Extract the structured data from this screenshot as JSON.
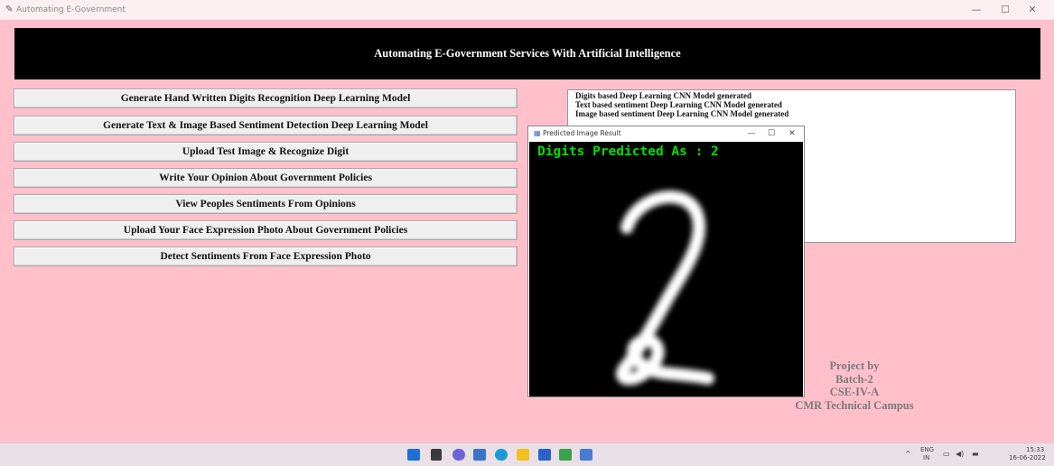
{
  "window": {
    "title": "Automating E-Government",
    "min_glyph": "—",
    "max_glyph": "☐",
    "close_glyph": "✕"
  },
  "header": {
    "title": "Automating E-Government Services With Artificial Intelligence"
  },
  "buttons": [
    "Generate Hand Written Digits Recognition Deep Learning Model",
    "Generate Text & Image Based Sentiment Detection Deep Learning Model",
    "Upload Test Image & Recognize Digit",
    "Write Your Opinion About Government Policies",
    "View Peoples Sentiments From Opinions",
    "Upload Your Face Expression Photo About Government Policies",
    "Detect Sentiments From Face Expression Photo"
  ],
  "output_lines": [
    "Digits based Deep Learning CNN Model generated",
    "Text based sentiment Deep Learning CNN Model generated",
    "Image based sentiment Deep Learning CNN Model generated"
  ],
  "credits": [
    "Project by",
    "Batch-2",
    "CSE-IV-A",
    "CMR Technical Campus"
  ],
  "popup": {
    "title": "Predicted Image Result",
    "prediction_text": "Digits Predicted As : 2",
    "min_glyph": "—",
    "max_glyph": "☐",
    "close_glyph": "✕"
  },
  "taskbar": {
    "lang_top": "ENG",
    "lang_bottom": "IN",
    "time": "15:33",
    "date": "16-06-2022",
    "tray_chevron": "^"
  },
  "colors": {
    "background": "#ffc0cb",
    "header": "#000000",
    "prediction": "#00e000"
  }
}
